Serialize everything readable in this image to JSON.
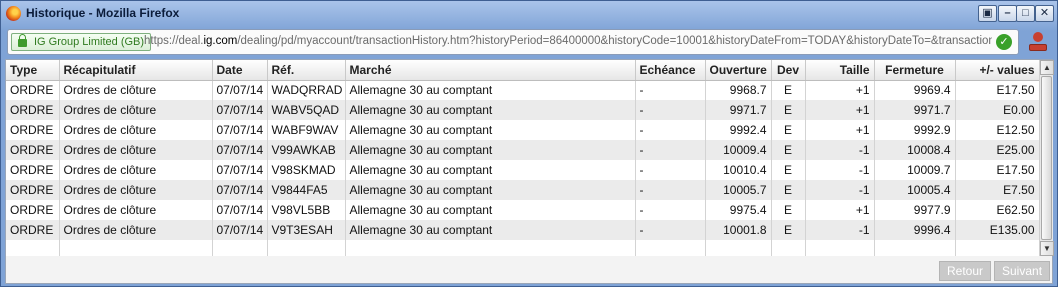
{
  "window": {
    "title": "Historique - Mozilla Firefox",
    "controls": [
      "restore",
      "minimize",
      "maximize",
      "close"
    ]
  },
  "urlbar": {
    "identity": "IG Group Limited (GB)",
    "url_prefix": "https://deal.",
    "url_domain": "ig.com",
    "url_rest": "/dealing/pd/myaccount/transactionHistory.htm?historyPeriod=86400000&historyCode=10001&historyDateFrom=TODAY&historyDateTo=&transactionHistor"
  },
  "table": {
    "headers": [
      "Type",
      "Récapitulatif",
      "Date",
      "Réf.",
      "Marché",
      "Echéance",
      "Ouverture",
      "Dev",
      "Taille",
      "Fermeture",
      "+/- values"
    ],
    "rows": [
      [
        "ORDRE",
        "Ordres de clôture",
        "07/07/14",
        "WADQRRAD",
        "Allemagne 30 au comptant",
        "-",
        "9968.7",
        "E",
        "+1",
        "9969.4",
        "E17.50"
      ],
      [
        "ORDRE",
        "Ordres de clôture",
        "07/07/14",
        "WABV5QAD",
        "Allemagne 30 au comptant",
        "-",
        "9971.7",
        "E",
        "+1",
        "9971.7",
        "E0.00"
      ],
      [
        "ORDRE",
        "Ordres de clôture",
        "07/07/14",
        "WABF9WAV",
        "Allemagne 30 au comptant",
        "-",
        "9992.4",
        "E",
        "+1",
        "9992.9",
        "E12.50"
      ],
      [
        "ORDRE",
        "Ordres de clôture",
        "07/07/14",
        "V99AWKAB",
        "Allemagne 30 au comptant",
        "-",
        "10009.4",
        "E",
        "-1",
        "10008.4",
        "E25.00"
      ],
      [
        "ORDRE",
        "Ordres de clôture",
        "07/07/14",
        "V98SKMAD",
        "Allemagne 30 au comptant",
        "-",
        "10010.4",
        "E",
        "-1",
        "10009.7",
        "E17.50"
      ],
      [
        "ORDRE",
        "Ordres de clôture",
        "07/07/14",
        "V9844FA5",
        "Allemagne 30 au comptant",
        "-",
        "10005.7",
        "E",
        "-1",
        "10005.4",
        "E7.50"
      ],
      [
        "ORDRE",
        "Ordres de clôture",
        "07/07/14",
        "V98VL5BB",
        "Allemagne 30 au comptant",
        "-",
        "9975.4",
        "E",
        "+1",
        "9977.9",
        "E62.50"
      ],
      [
        "ORDRE",
        "Ordres de clôture",
        "07/07/14",
        "V9T3ESAH",
        "Allemagne 30 au comptant",
        "-",
        "10001.8",
        "E",
        "-1",
        "9996.4",
        "E135.00"
      ]
    ]
  },
  "footer": {
    "back_label": "Retour",
    "next_label": "Suivant"
  }
}
